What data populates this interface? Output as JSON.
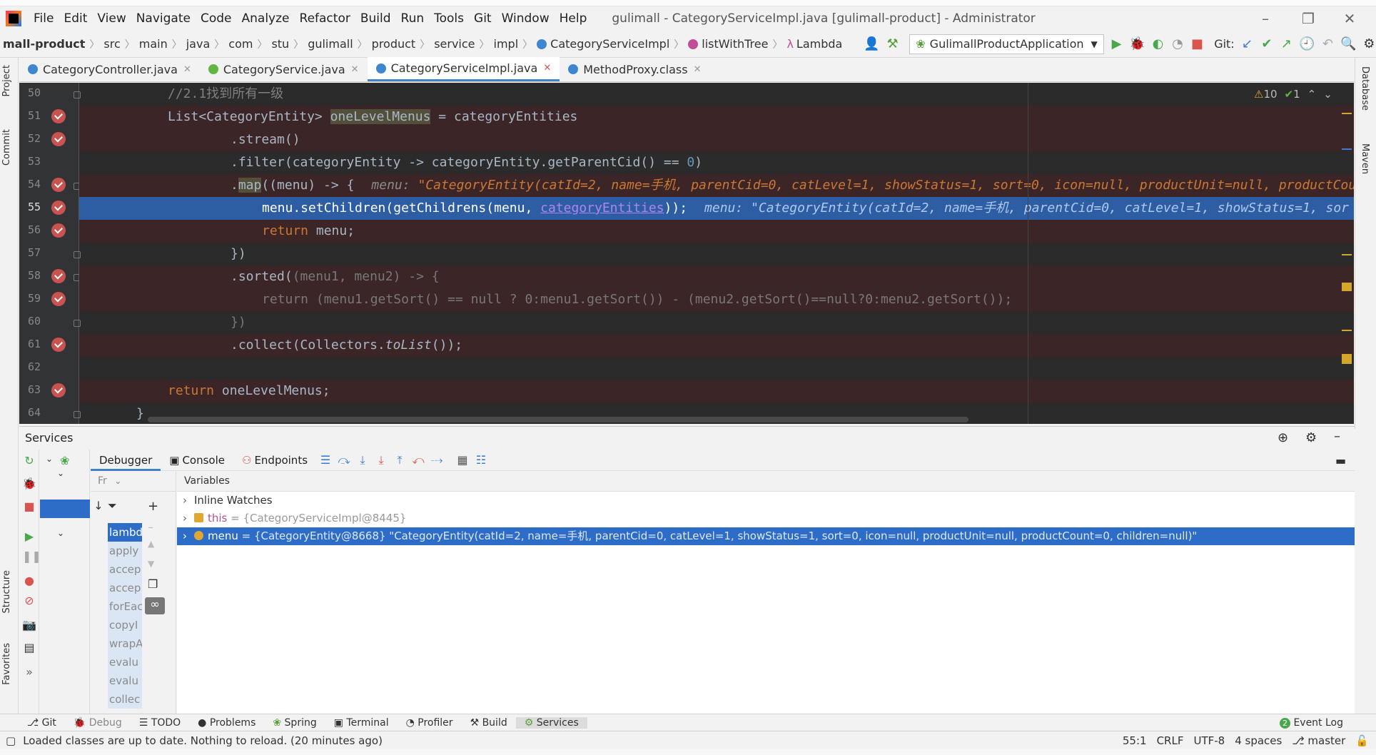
{
  "menu": {
    "items": [
      "File",
      "Edit",
      "View",
      "Navigate",
      "Code",
      "Analyze",
      "Refactor",
      "Build",
      "Run",
      "Tools",
      "Git",
      "Window",
      "Help"
    ],
    "window_title": "gulimall - CategoryServiceImpl.java [gulimall-product] - Administrator"
  },
  "navbar": {
    "crumbs": [
      "mall-product",
      "src",
      "main",
      "java",
      "com",
      "stu",
      "gulimall",
      "product",
      "service",
      "impl",
      "CategoryServiceImpl",
      "listWithTree",
      "Lambda"
    ],
    "run_config": "GulimallProductApplication",
    "git_label": "Git:"
  },
  "tabs": [
    {
      "label": "CategoryController.java",
      "color": "#3e86d0"
    },
    {
      "label": "CategoryService.java",
      "color": "#62b543"
    },
    {
      "label": "CategoryServiceImpl.java",
      "color": "#3e86d0"
    },
    {
      "label": "MethodProxy.class",
      "color": "#3e86d0"
    }
  ],
  "editor": {
    "line_numbers": [
      "50",
      "51",
      "52",
      "53",
      "54",
      "55",
      "56",
      "57",
      "58",
      "59",
      "60",
      "61",
      "62",
      "63",
      "64"
    ],
    "line50": "//2.1找到所有一级",
    "line51": {
      "a": "List<CategoryEntity> ",
      "b": "oneLevelMenus",
      "c": " = categoryEntities"
    },
    "line52": ".stream()",
    "line53": {
      "a": ".filter(categoryEntity -> categoryEntity.getParentCid() == ",
      "b": "0",
      "c": ")"
    },
    "line54": {
      "a": ".",
      "b": "map",
      "c": "((menu) -> {",
      "lbl": "menu: ",
      "val": "\"CategoryEntity(catId=2, name=手机, parentCid=0, catLevel=1, showStatus=1, sort=0, icon=null, productUnit=null, productCou"
    },
    "line55": {
      "a": "menu.setChildren(getChildrens(menu, ",
      "b": "categoryEntities",
      "c": "));",
      "lbl": "menu: ",
      "val": "\"CategoryEntity(catId=2, name=手机, parentCid=0, catLevel=1, showStatus=1, sor"
    },
    "line56": {
      "a": "return",
      "b": " menu;"
    },
    "line57": "})",
    "line58": {
      "a": ".sorted(",
      "b": "(menu1, menu2) -> {"
    },
    "line59": "return (menu1.getSort() == null ? 0:menu1.getSort()) - (menu2.getSort()==null?0:menu2.getSort());",
    "line60": "})",
    "line61": {
      "a": ".collect(Collectors.",
      "b": "toList",
      "c": "());"
    },
    "line63": {
      "a": "return",
      "b": " oneLevelMenus;"
    },
    "line64": "}",
    "warnings": "10",
    "oks": "1"
  },
  "services": {
    "title": "Services",
    "tabs": [
      "Debugger",
      "Console",
      "Endpoints"
    ],
    "frames_header": "Fr",
    "variables_header": "Variables",
    "frames": [
      "lambd",
      "apply",
      "accep",
      "accep",
      "forEac",
      "copyI",
      "wrapA",
      "evalu",
      "evalu",
      "collec"
    ],
    "vars": {
      "inline_watches": "Inline Watches",
      "this_name": "this",
      "this_value": " = {CategoryServiceImpl@8445}",
      "menu_name": "menu",
      "menu_value": " = {CategoryEntity@8668} \"CategoryEntity(catId=2, name=手机, parentCid=0, catLevel=1, showStatus=1, sort=0, icon=null, productUnit=null, productCount=0, children=null)\""
    }
  },
  "bottom_tabs": [
    "Git",
    "Debug",
    "TODO",
    "Problems",
    "Spring",
    "Terminal",
    "Profiler",
    "Build",
    "Services"
  ],
  "event_log": "Event Log",
  "event_log_count": "2",
  "status": {
    "message": "Loaded classes are up to date. Nothing to reload. (20 minutes ago)",
    "position": "55:1",
    "line_sep": "CRLF",
    "encoding": "UTF-8",
    "indent": "4 spaces",
    "branch": "master"
  },
  "side_tabs": {
    "project": "Project",
    "commit": "Commit",
    "structure": "Structure",
    "favorites": "Favorites",
    "database": "Database",
    "maven": "Maven"
  }
}
